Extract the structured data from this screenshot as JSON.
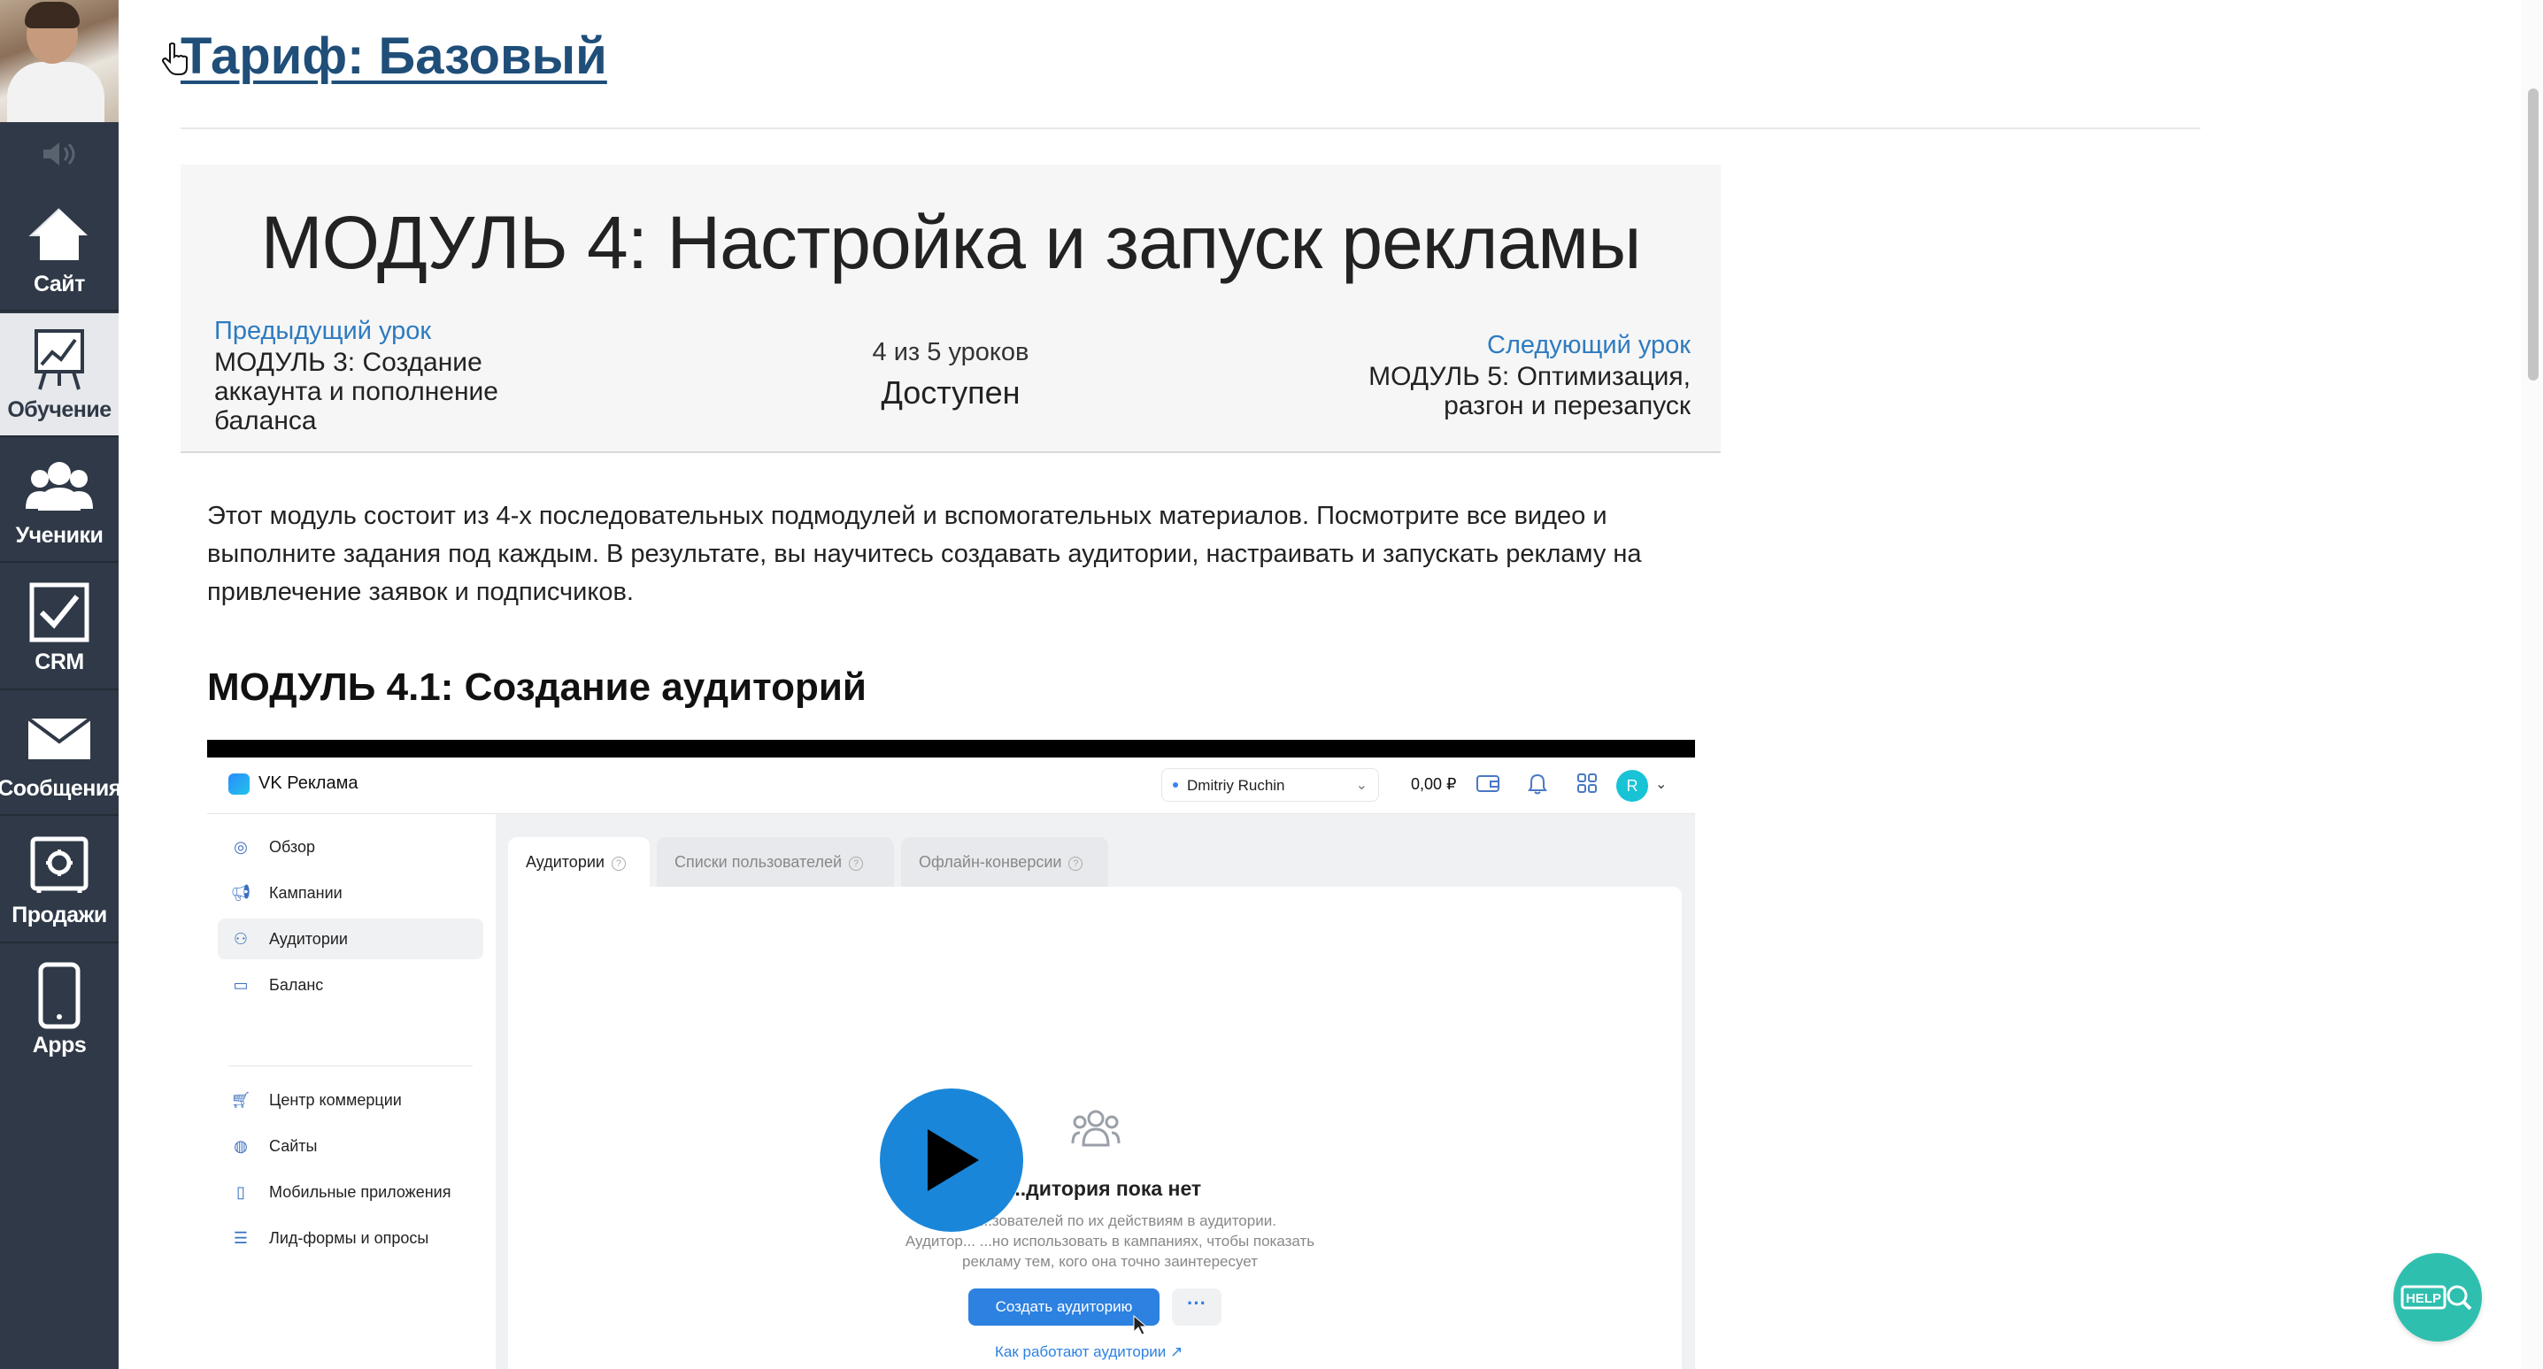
{
  "sidebar": {
    "items": [
      {
        "label": "Сайт",
        "icon": "home-icon"
      },
      {
        "label": "Обучение",
        "icon": "chart-board-icon",
        "active": true
      },
      {
        "label": "Ученики",
        "icon": "users-icon"
      },
      {
        "label": "CRM",
        "icon": "checkbox-icon"
      },
      {
        "label": "Сообщения",
        "icon": "mail-icon"
      },
      {
        "label": "Продажи",
        "icon": "safe-icon"
      },
      {
        "label": "Apps",
        "icon": "phone-icon"
      }
    ]
  },
  "page": {
    "title": "Тариф: Базовый"
  },
  "module": {
    "title": "МОДУЛЬ 4: Настройка и запуск рекламы",
    "prev_label": "Предыдущий урок",
    "prev_name": "МОДУЛЬ 3: Создание аккаунта и пополнение баланса",
    "count": "4 из 5 уроков",
    "status": "Доступен",
    "next_label": "Следующий урок",
    "next_name": "МОДУЛЬ 5: Оптимизация, разгон и перезапуск"
  },
  "content": {
    "description": "Этот модуль состоит из 4-х последовательных подмодулей и вспомогательных материалов. Посмотрите все видео и выполните задания под каждым. В результате, вы научитесь создавать аудитории, настраивать и запускать рекламу на привлечение заявок и подписчиков.",
    "subheading": "МОДУЛЬ 4.1: Создание аудиторий"
  },
  "video": {
    "brand": "VK Реклама",
    "user": "Dmitriy Ruchin",
    "balance": "0,00 ₽",
    "avatar_letter": "R",
    "nav": [
      {
        "label": "Обзор",
        "icon": "compass-icon"
      },
      {
        "label": "Кампании",
        "icon": "megaphone-icon"
      },
      {
        "label": "Аудитории",
        "icon": "audience-icon",
        "active": true
      },
      {
        "label": "Баланс",
        "icon": "wallet-icon"
      },
      {
        "label": "Центр коммерции",
        "icon": "cart-icon"
      },
      {
        "label": "Сайты",
        "icon": "globe-icon"
      },
      {
        "label": "Мобильные приложения",
        "icon": "mobile-icon"
      },
      {
        "label": "Лид-формы и опросы",
        "icon": "form-icon"
      }
    ],
    "tabs": [
      "Аудитории",
      "Списки пользователей",
      "Офлайн-конверсии"
    ],
    "empty_title": "...дитория пока нет",
    "empty_line1": "Со...    ...зователей по их действиям в аудитории.",
    "empty_line2": "Аудитор...    ...но использовать в кампаниях, чтобы показать",
    "empty_line3": "рекламу тем, кого она точно заинтересует",
    "create_button": "Создать аудиторию",
    "more_button": "···",
    "how_link": "Как работают аудитории ↗"
  },
  "help": {
    "label": "HELP"
  },
  "colors": {
    "sidebar_bg": "#2f3947",
    "title_link": "#1f4e79",
    "accent_link": "#2e7bbf",
    "play_button": "#1a86d9",
    "help_button": "#2fbfae"
  }
}
